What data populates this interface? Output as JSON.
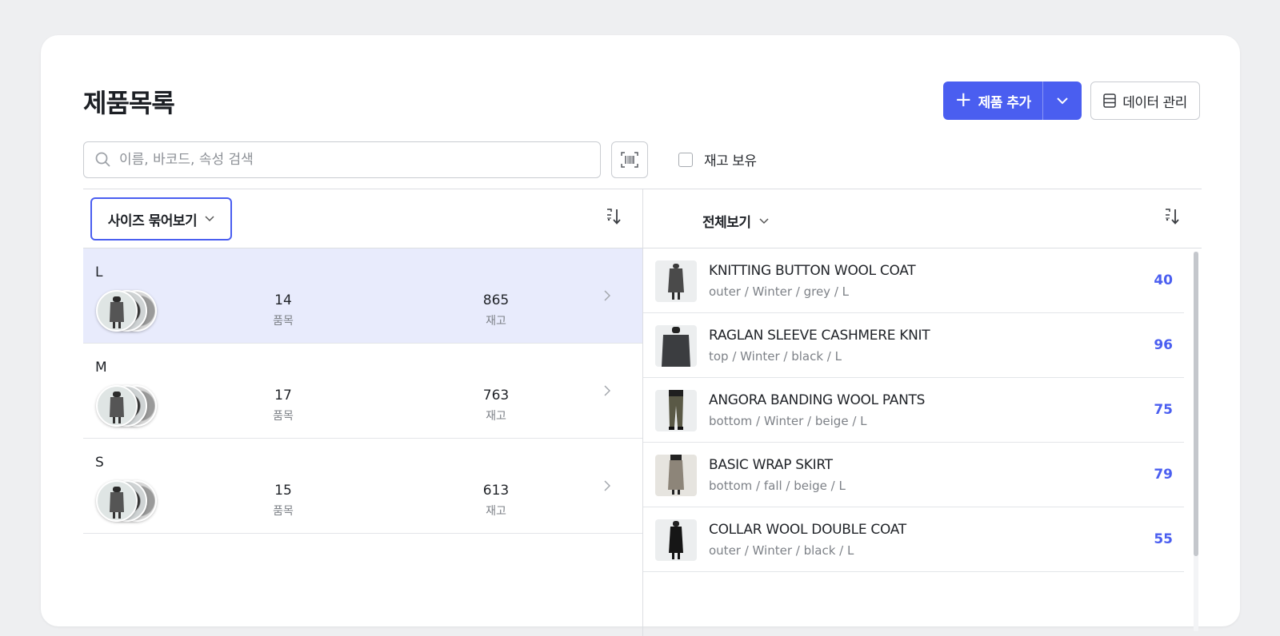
{
  "header": {
    "title": "제품목록",
    "add_product_label": "제품 추가",
    "data_manage_label": "데이터 관리"
  },
  "search": {
    "placeholder": "이름, 바코드, 속성 검색",
    "value": ""
  },
  "filters": {
    "in_stock_label": "재고 보유",
    "in_stock_checked": false
  },
  "left_panel": {
    "group_by_label": "사이즈 묶어보기",
    "groups": [
      {
        "size": "L",
        "items_count": "14",
        "items_label": "품목",
        "stock_count": "865",
        "stock_label": "재고",
        "selected": true
      },
      {
        "size": "M",
        "items_count": "17",
        "items_label": "품목",
        "stock_count": "763",
        "stock_label": "재고",
        "selected": false
      },
      {
        "size": "S",
        "items_count": "15",
        "items_label": "품목",
        "stock_count": "613",
        "stock_label": "재고",
        "selected": false
      }
    ]
  },
  "right_panel": {
    "filter_label": "전체보기",
    "products": [
      {
        "name": "KNITTING BUTTON WOOL COAT",
        "meta": "outer / Winter / grey / L",
        "qty": "40",
        "image": "grey-coat-photo"
      },
      {
        "name": "RAGLAN SLEEVE CASHMERE KNIT",
        "meta": "top / Winter / black / L",
        "qty": "96",
        "image": "dark-knit-photo"
      },
      {
        "name": "ANGORA BANDING WOOL PANTS",
        "meta": "bottom / Winter / beige / L",
        "qty": "75",
        "image": "olive-pants-photo"
      },
      {
        "name": "BASIC WRAP SKIRT",
        "meta": "bottom / fall / beige / L",
        "qty": "79",
        "image": "beige-skirt-photo"
      },
      {
        "name": "COLLAR WOOL DOUBLE COAT",
        "meta": "outer / Winter / black / L",
        "qty": "55",
        "image": "black-coat-photo"
      }
    ]
  },
  "colors": {
    "accent": "#4a5ef0",
    "selected_row": "#e8ebfc",
    "background": "#eeeff1"
  }
}
